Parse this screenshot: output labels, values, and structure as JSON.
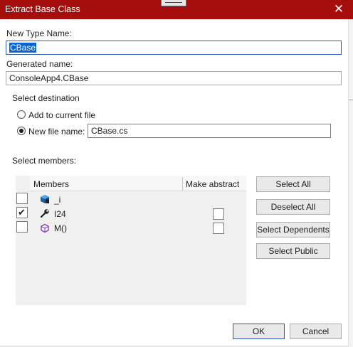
{
  "window": {
    "title": "Extract Base Class",
    "close_glyph": "✕"
  },
  "new_type": {
    "label": "New Type Name:",
    "value": "CBase"
  },
  "generated": {
    "label": "Generated name:",
    "value": "ConsoleApp4.CBase"
  },
  "destination": {
    "heading": "Select destination",
    "add_current_label": "Add to current file",
    "new_file_label": "New file name:",
    "new_file_value": "CBase.cs",
    "selected": "new_file"
  },
  "members": {
    "heading": "Select members:",
    "col_members": "Members",
    "col_abstract": "Make abstract",
    "rows": [
      {
        "name": "_i",
        "icon": "field-icon",
        "checked": false,
        "has_abstract": false,
        "abstract": false
      },
      {
        "name": "I24",
        "icon": "property-icon",
        "checked": true,
        "has_abstract": true,
        "abstract": false
      },
      {
        "name": "M()",
        "icon": "method-icon",
        "checked": false,
        "has_abstract": true,
        "abstract": false
      }
    ]
  },
  "buttons": {
    "select_all": "Select All",
    "deselect_all": "Deselect All",
    "select_dependents": "Select Dependents",
    "select_public": "Select Public",
    "ok": "OK",
    "cancel": "Cancel"
  },
  "colors": {
    "titlebar": "#a60d0d",
    "focus_border": "#2a57a8",
    "selection": "#0a64d6",
    "field_icon": "#1c5fa8",
    "method_icon": "#7a3fbf"
  }
}
